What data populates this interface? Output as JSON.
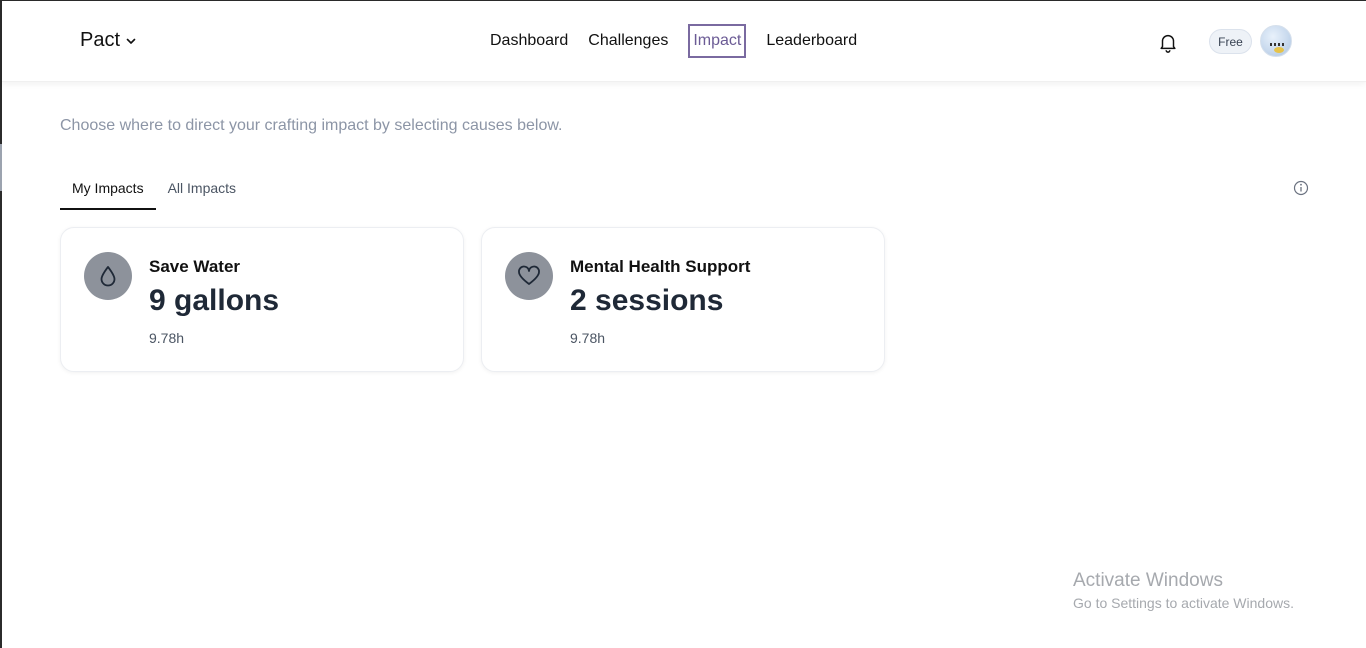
{
  "header": {
    "brand": "Pact",
    "nav": [
      "Dashboard",
      "Challenges",
      "Impact",
      "Leaderboard"
    ],
    "active_nav": "Impact",
    "plan_badge": "Free"
  },
  "intro_text": "Choose where to direct your crafting impact by selecting causes below.",
  "tabs": [
    {
      "label": "My Impacts",
      "active": true
    },
    {
      "label": "All Impacts",
      "active": false
    }
  ],
  "cards": [
    {
      "title": "Save Water",
      "value": "9 gallons",
      "sub": "9.78h",
      "icon": "water-drop-icon"
    },
    {
      "title": "Mental Health Support",
      "value": "2 sessions",
      "sub": "9.78h",
      "icon": "heart-icon"
    }
  ],
  "watermark": {
    "title": "Activate Windows",
    "subtitle": "Go to Settings to activate Windows."
  },
  "colors": {
    "active_nav": "#6b5b95",
    "muted_text": "#8c95a6",
    "icon_circle": "#8d929b"
  }
}
